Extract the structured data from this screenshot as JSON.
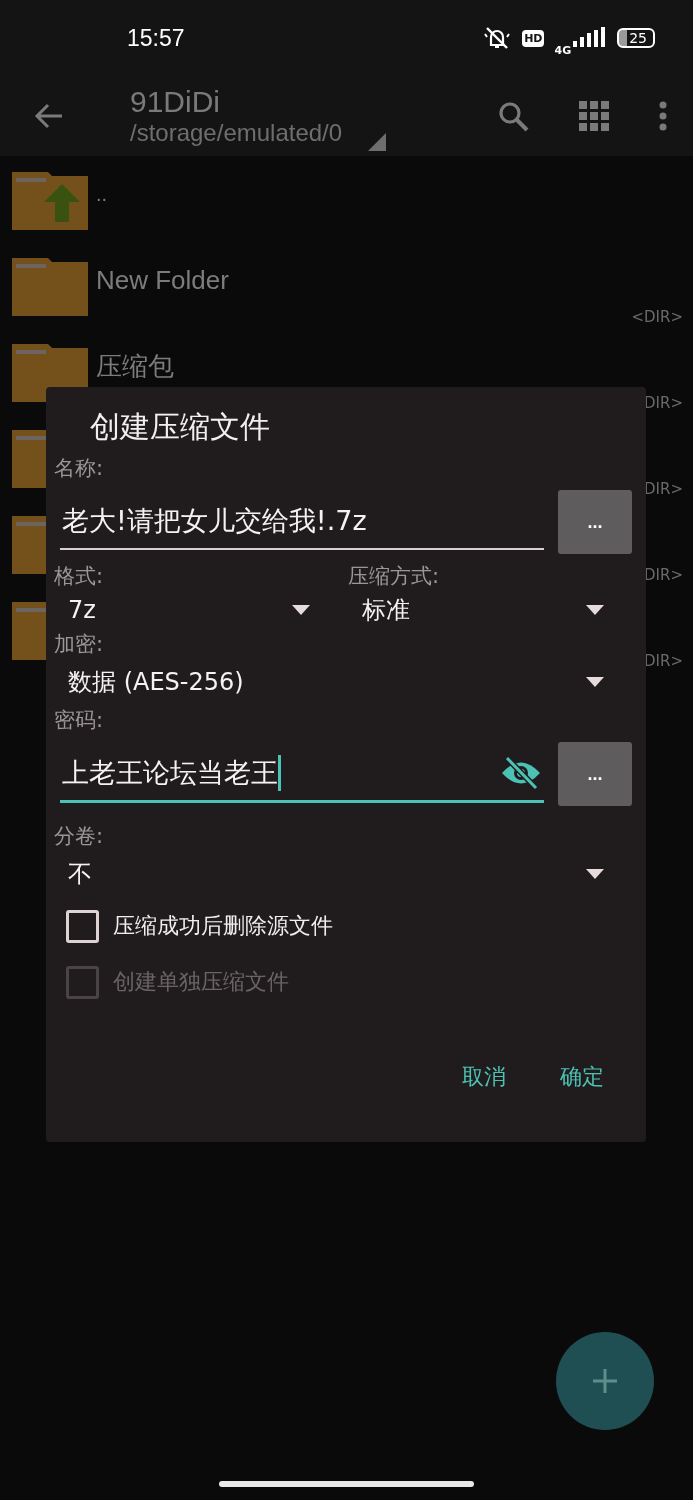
{
  "status_bar": {
    "time": "15:57",
    "network": "4G",
    "hd": "HD",
    "battery": "25"
  },
  "toolbar": {
    "title": "91DiDi",
    "path": "/storage/emulated/0"
  },
  "files": [
    {
      "name": "..",
      "kind": "parent"
    },
    {
      "name": "New Folder",
      "kind": "folder",
      "tag": "<DIR>"
    },
    {
      "name": "压缩包",
      "kind": "folder",
      "tag": "DIR>"
    },
    {
      "kind": "folder",
      "tag": "DIR>"
    },
    {
      "kind": "folder",
      "tag": "DIR>"
    },
    {
      "kind": "folder",
      "tag": "DIR>"
    }
  ],
  "dialog": {
    "title": "创建压缩文件",
    "name": {
      "label": "名称:",
      "value": "老大!请把女儿交给我!.7z",
      "focused": false,
      "button": "..."
    },
    "format": {
      "label": "格式:",
      "value": "7z"
    },
    "method": {
      "label": "压缩方式:",
      "value": "标准"
    },
    "encryption": {
      "label": "加密:",
      "value": "数据 (AES-256)"
    },
    "password": {
      "label": "密码:",
      "value": "上老王论坛当老王",
      "focused": true,
      "button": "..."
    },
    "split": {
      "label": "分卷:",
      "value": "不"
    },
    "options": [
      {
        "label": "压缩成功后删除源文件",
        "checked": false,
        "disabled": false
      },
      {
        "label": "创建单独压缩文件",
        "checked": false,
        "disabled": true
      }
    ],
    "buttons": [
      "取消",
      "确定"
    ]
  }
}
